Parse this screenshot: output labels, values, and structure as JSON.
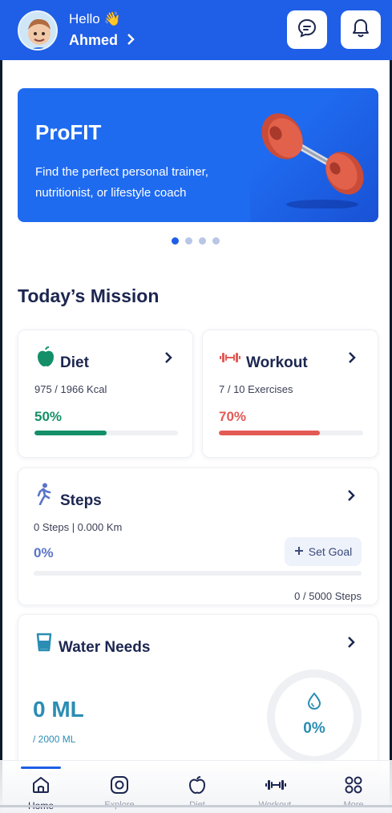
{
  "header": {
    "greeting": "Hello 👋",
    "user_name": "Ahmed",
    "icons": {
      "chat": "chat-bubble-icon",
      "notifications": "bell-icon"
    }
  },
  "banner": {
    "title": "ProFIT",
    "description": "Find the perfect personal trainer, nutritionist, or lifestyle coach",
    "slides_total": 4,
    "active_slide": 1
  },
  "mission": {
    "title": "Today’s Mission",
    "diet": {
      "title": "Diet",
      "detail": "975 / 1966 Kcal",
      "percent_label": "50%",
      "progress": 0.5,
      "color": "#148f68",
      "icon": "apple-icon"
    },
    "workout": {
      "title": "Workout",
      "detail": "7 / 10 Exercises",
      "percent_label": "70%",
      "progress": 0.7,
      "color": "#e35a55",
      "icon": "dumbbell-icon"
    },
    "steps": {
      "title": "Steps",
      "detail": "0 Steps | 0.000 Km",
      "percent_label": "0%",
      "progress": 0,
      "set_goal_label": "Set Goal",
      "goal_text": "0 / 5000 Steps",
      "color": "#5a74c9",
      "icon": "walking-person-icon"
    },
    "water": {
      "title": "Water Needs",
      "amount": "0 ML",
      "goal": "/ 2000 ML",
      "percent_label": "0%",
      "progress": 0,
      "color": "#2b8db3",
      "icon": "water-glass-icon"
    }
  },
  "bottom_nav": {
    "items": [
      {
        "label": "Home",
        "icon": "home-icon",
        "active": true
      },
      {
        "label": "Explore",
        "icon": "compass-icon",
        "active": false
      },
      {
        "label": "Diet",
        "icon": "apple-icon",
        "active": false
      },
      {
        "label": "Workout",
        "icon": "dumbbell-icon",
        "active": false
      },
      {
        "label": "More",
        "icon": "grid-icon",
        "active": false
      }
    ]
  },
  "colors": {
    "primary": "#1f5ee6",
    "banner": "#1f6bf0",
    "heading": "#1c2650"
  }
}
